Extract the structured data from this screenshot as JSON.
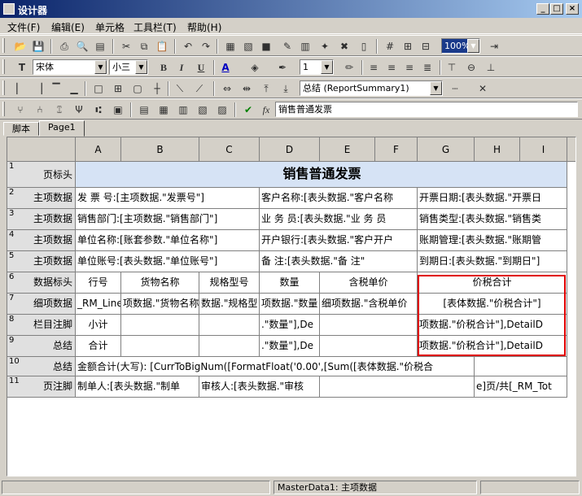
{
  "window": {
    "title": "设计器"
  },
  "menu": [
    "文件(F)",
    "编辑(E)",
    "单元格",
    "工具栏(T)",
    "帮助(H)"
  ],
  "format": {
    "font": "宋体",
    "size": "小三",
    "line_width": "1"
  },
  "band": {
    "selected": "总结 (ReportSummary1)"
  },
  "formula": {
    "value": "销售普通发票"
  },
  "zoom": "100%",
  "tabs": [
    "脚本",
    "Page1"
  ],
  "columns": [
    "A",
    "B",
    "C",
    "D",
    "E",
    "F",
    "G",
    "H",
    "I"
  ],
  "rows": [
    {
      "num": "1",
      "label": "页标头"
    },
    {
      "num": "2",
      "label": "主项数据"
    },
    {
      "num": "3",
      "label": "主项数据"
    },
    {
      "num": "4",
      "label": "主项数据"
    },
    {
      "num": "5",
      "label": "主项数据"
    },
    {
      "num": "6",
      "label": "数据标头"
    },
    {
      "num": "7",
      "label": "细项数据"
    },
    {
      "num": "8",
      "label": "栏目注脚"
    },
    {
      "num": "9",
      "label": "总结"
    },
    {
      "num": "10",
      "label": "总结"
    },
    {
      "num": "11",
      "label": "页注脚"
    }
  ],
  "cells": {
    "r1": "销售普通发票",
    "r2": [
      "发 票 号:[主项数据.\"发票号\"]",
      "客户名称:[表头数据.\"客户名称",
      "开票日期:[表头数据.\"开票日"
    ],
    "r3": [
      "销售部门:[主项数据.\"销售部门\"]",
      "业 务 员:[表头数据.\"业 务 员",
      "销售类型:[表头数据.\"销售类"
    ],
    "r4": [
      "单位名称:[账套参数.\"单位名称\"]",
      "开户银行:[表头数据.\"客户开户",
      "账期管理:[表头数据.\"账期管"
    ],
    "r5": [
      "单位账号:[表头数据.\"单位账号\"]",
      "备    注:[表头数据.\"备    注\"",
      "到期日:[表头数据.\"到期日\"]"
    ],
    "r6": [
      "行号",
      "货物名称",
      "规格型号",
      "数量",
      "含税单价",
      "价税合计"
    ],
    "r7": [
      "_RM_Line",
      "项数据.\"货物名称",
      "数据.\"规格型",
      "项数据.\"数量",
      "细项数据.\"含税单价",
      "[表体数据.\"价税合计\"]"
    ],
    "r8": [
      "小计",
      ".\"数量\"],De",
      "项数据.\"价税合计\"],DetailD"
    ],
    "r9": [
      "合计",
      ".\"数量\"],De",
      "项数据.\"价税合计\"],DetailD"
    ],
    "r10": "金额合计(大写): [CurrToBigNum([FormatFloat('0.00',[Sum([表体数据.\"价税合",
    "r11": [
      "制单人:[表头数据.\"制单",
      "审核人:[表头数据.\"审核",
      "e]页/共[_RM_Tot"
    ]
  },
  "status": {
    "band": "MasterData1: 主项数据"
  }
}
